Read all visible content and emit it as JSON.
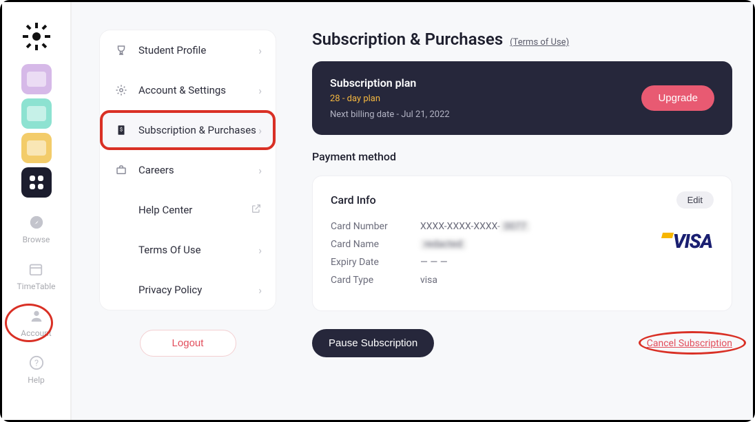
{
  "sidebar": {
    "color_boxes": [
      "#d6b9e8",
      "#8de2d1",
      "#f3cc6a"
    ],
    "nav": [
      {
        "label": "Browse"
      },
      {
        "label": "TimeTable"
      },
      {
        "label": "Account"
      },
      {
        "label": "Help"
      }
    ]
  },
  "settings_menu": {
    "items": [
      {
        "label": "Student Profile",
        "icon": "trophy"
      },
      {
        "label": "Account & Settings",
        "icon": "gear"
      },
      {
        "label": "Subscription & Purchases",
        "icon": "receipt",
        "active": true,
        "highlight": true
      },
      {
        "label": "Careers",
        "icon": "briefcase"
      },
      {
        "label": "Help Center",
        "icon": "external"
      },
      {
        "label": "Terms Of Use",
        "icon": "chev"
      },
      {
        "label": "Privacy Policy",
        "icon": "chev"
      }
    ],
    "logout": "Logout"
  },
  "main": {
    "title": "Subscription & Purchases",
    "terms_link": "(Terms of Use)",
    "plan": {
      "heading": "Subscription plan",
      "plan_name": "28 - day plan",
      "next_billing": "Next billing date - Jul 21, 2022",
      "upgrade": "Upgrade"
    },
    "payment_method_title": "Payment method",
    "card": {
      "title": "Card Info",
      "edit": "Edit",
      "rows": {
        "card_number_label": "Card Number",
        "card_number_value": "XXXX-XXXX-XXXX-",
        "card_number_blur": "0077",
        "card_name_label": "Card Name",
        "card_name_blur": "redacted",
        "expiry_label": "Expiry Date",
        "expiry_value": "— — —",
        "card_type_label": "Card Type",
        "card_type_value": "visa"
      },
      "brand": "VISA"
    },
    "pause": "Pause Subscription",
    "cancel": "Cancel Subscription"
  }
}
